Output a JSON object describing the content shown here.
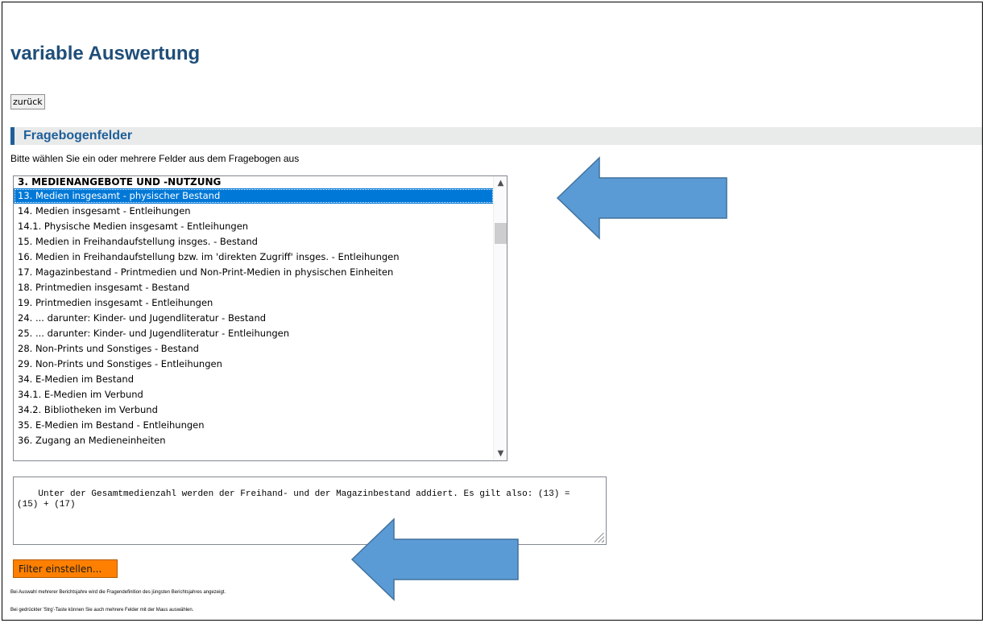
{
  "page": {
    "title": "variable Auswertung",
    "back_label": "zurück"
  },
  "section": {
    "title": "Fragebogenfelder",
    "instruction": "Bitte wählen Sie ein oder mehrere Felder aus dem Fragebogen aus"
  },
  "field_list": {
    "group_header": "3. MEDIENANGEBOTE UND -NUTZUNG",
    "selected_index": 0,
    "items": [
      {
        "label": "13. Medien insgesamt - physischer Bestand"
      },
      {
        "label": "14. Medien insgesamt - Entleihungen"
      },
      {
        "label": "14.1. Physische Medien insgesamt - Entleihungen"
      },
      {
        "label": "15. Medien in Freihandaufstellung insges. - Bestand"
      },
      {
        "label": "16. Medien in Freihandaufstellung bzw. im 'direkten Zugriff' insges. - Entleihungen"
      },
      {
        "label": "17. Magazinbestand - Printmedien und Non-Print-Medien in physischen Einheiten"
      },
      {
        "label": "18. Printmedien insgesamt - Bestand"
      },
      {
        "label": "19. Printmedien insgesamt - Entleihungen"
      },
      {
        "label": "24. ... darunter: Kinder- und Jugendliteratur - Bestand"
      },
      {
        "label": "25. ... darunter: Kinder- und Jugendliteratur - Entleihungen"
      },
      {
        "label": "28. Non-Prints und Sonstiges - Bestand"
      },
      {
        "label": "29. Non-Prints und Sonstiges - Entleihungen"
      },
      {
        "label": "34. E-Medien im Bestand"
      },
      {
        "label": "34.1. E-Medien im Verbund"
      },
      {
        "label": "34.2. Bibliotheken im Verbund"
      },
      {
        "label": "35. E-Medien im Bestand - Entleihungen"
      },
      {
        "label": "36. Zugang an Medieneinheiten"
      }
    ]
  },
  "description": {
    "text": "Unter der Gesamtmedienzahl werden der Freihand- und der Magazinbestand addiert. Es gilt also: (13) =\n(15) + (17)"
  },
  "filter_button": {
    "label": "Filter einstellen..."
  },
  "notes": [
    "Bei Auswahl mehrerer Berichtsjahre wird die Fragendefinition des jüngsten Berichtsjahres angezeigt.",
    "Bei gedrückter 'Strg'-Taste können Sie auch mehrere Felder mit der Maus auswählen."
  ],
  "colors": {
    "title": "#1f4e79",
    "section_accent": "#1f5f99",
    "selection": "#0078d7",
    "filter_button": "#ff8000",
    "arrow_fill": "#5b9bd5",
    "arrow_stroke": "#41719c"
  },
  "icons": {
    "scroll_up": "chevron-up-icon",
    "scroll_down": "chevron-down-icon",
    "resize": "resize-grip-icon",
    "annotation": "left-arrow-icon"
  }
}
